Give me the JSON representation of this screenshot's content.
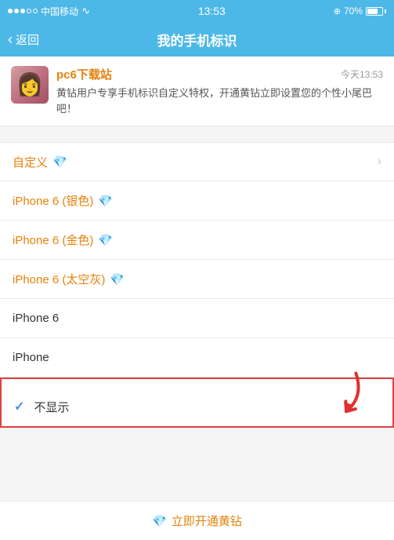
{
  "statusBar": {
    "carrier": "中国移动",
    "time": "13:53",
    "battery": "70%",
    "batterySymbol": "⊡"
  },
  "navBar": {
    "backLabel": "返回",
    "title": "我的手机标识"
  },
  "messageCard": {
    "senderName": "pc6下载站",
    "time": "今天13:53",
    "text": "黄钻用户专享手机标识自定义特权，开通黄钻立即设置您的个性小尾巴吧！"
  },
  "listItems": [
    {
      "id": "custom",
      "label": "自定义",
      "hasGem": true,
      "isOrange": true,
      "hasChevron": true,
      "isSelected": false
    },
    {
      "id": "iphone6-silver",
      "label": "iPhone 6 (银色)",
      "hasGem": true,
      "isOrange": true,
      "hasChevron": false,
      "isSelected": false
    },
    {
      "id": "iphone6-gold",
      "label": "iPhone 6 (金色)",
      "hasGem": true,
      "isOrange": true,
      "hasChevron": false,
      "isSelected": false
    },
    {
      "id": "iphone6-spacegray",
      "label": "iPhone 6 (太空灰)",
      "hasGem": true,
      "isOrange": true,
      "hasChevron": false,
      "isSelected": false
    },
    {
      "id": "iphone6",
      "label": "iPhone 6",
      "hasGem": false,
      "isOrange": false,
      "hasChevron": false,
      "isSelected": false
    },
    {
      "id": "iphone",
      "label": "iPhone",
      "hasGem": false,
      "isOrange": false,
      "hasChevron": false,
      "isSelected": false
    },
    {
      "id": "hide",
      "label": "不显示",
      "hasGem": false,
      "isOrange": false,
      "hasChevron": false,
      "isSelected": true
    }
  ],
  "footer": {
    "gemIcon": "💎",
    "text": "立即开通黄钻"
  },
  "gemIcon": "💎",
  "checkIcon": "✓",
  "chevronIcon": "›"
}
